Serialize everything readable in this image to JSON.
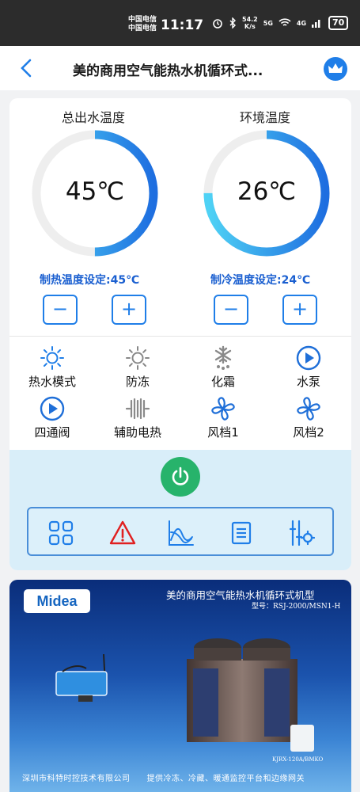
{
  "status_bar": {
    "carrier_1": "中国电信",
    "carrier_2": "中国电信",
    "time": "11:17",
    "speed_value": "54.2",
    "speed_unit": "K/s",
    "signal_5g": "5G",
    "signal_4g": "4G",
    "battery": "70"
  },
  "header": {
    "title": "美的商用空气能热水机循环式..."
  },
  "gauges": [
    {
      "title": "总出水温度",
      "value": "45℃",
      "level": 0.5,
      "setpoint": "制热温度设定:45℃"
    },
    {
      "title": "环境温度",
      "value": "26℃",
      "level": 0.75,
      "setpoint": "制冷温度设定:24℃"
    }
  ],
  "stepper": {
    "minus": "−",
    "plus": "+"
  },
  "status_items": [
    {
      "label": "热水模式",
      "icon": "sun-icon"
    },
    {
      "label": "防冻",
      "icon": "sun-outline-icon"
    },
    {
      "label": "化霜",
      "icon": "snowflake-icon"
    },
    {
      "label": "水泵",
      "icon": "play-circle-icon"
    },
    {
      "label": "四通阀",
      "icon": "play-circle-icon"
    },
    {
      "label": "辅助电热",
      "icon": "heater-icon"
    },
    {
      "label": "风档1",
      "icon": "fan-icon"
    },
    {
      "label": "风档2",
      "icon": "fan-icon"
    }
  ],
  "toolbar": [
    "grid-icon",
    "warning-icon",
    "chart-icon",
    "list-icon",
    "settings-icon"
  ],
  "banner": {
    "logo": "Midea",
    "title": "美的商用空气能热水机循环式机型",
    "model": "型号：RSJ-2000/MSN1-H",
    "panel_label": "KJRX-120A/BMKO",
    "footer": "深圳市科特时控技术有限公司　　提供冷冻、冷藏、暖通监控平台和边缘网关"
  },
  "colors": {
    "accent": "#1f7ee8",
    "gauge_track": "#eeeeee",
    "power": "#27b36b",
    "warning": "#e02020"
  }
}
